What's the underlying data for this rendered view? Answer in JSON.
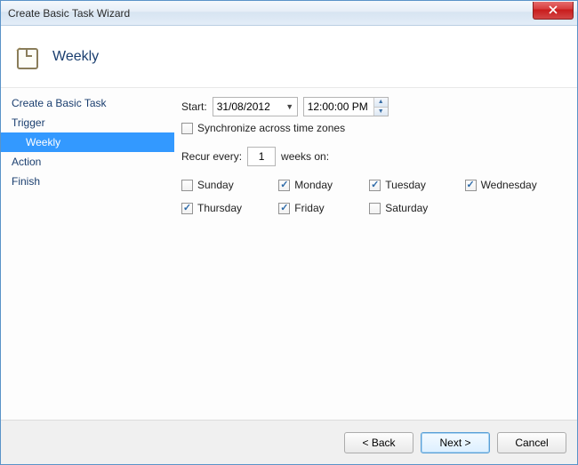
{
  "window": {
    "title": "Create Basic Task Wizard"
  },
  "header": {
    "title": "Weekly"
  },
  "sidebar": {
    "items": [
      {
        "label": "Create a Basic Task",
        "child": false,
        "selected": false
      },
      {
        "label": "Trigger",
        "child": false,
        "selected": false
      },
      {
        "label": "Weekly",
        "child": true,
        "selected": true
      },
      {
        "label": "Action",
        "child": false,
        "selected": false
      },
      {
        "label": "Finish",
        "child": false,
        "selected": false
      }
    ]
  },
  "form": {
    "start_label": "Start:",
    "date_value": "31/08/2012",
    "time_value": "12:00:00 PM",
    "sync_label": "Synchronize across time zones",
    "sync_checked": false,
    "recur_label": "Recur every:",
    "recur_value": "1",
    "recur_suffix": "weeks on:",
    "days": [
      {
        "key": "sunday",
        "label": "Sunday",
        "checked": false
      },
      {
        "key": "monday",
        "label": "Monday",
        "checked": true
      },
      {
        "key": "tuesday",
        "label": "Tuesday",
        "checked": true
      },
      {
        "key": "wednesday",
        "label": "Wednesday",
        "checked": true
      },
      {
        "key": "thursday",
        "label": "Thursday",
        "checked": true
      },
      {
        "key": "friday",
        "label": "Friday",
        "checked": true
      },
      {
        "key": "saturday",
        "label": "Saturday",
        "checked": false
      }
    ]
  },
  "footer": {
    "back": "< Back",
    "next": "Next >",
    "cancel": "Cancel"
  }
}
